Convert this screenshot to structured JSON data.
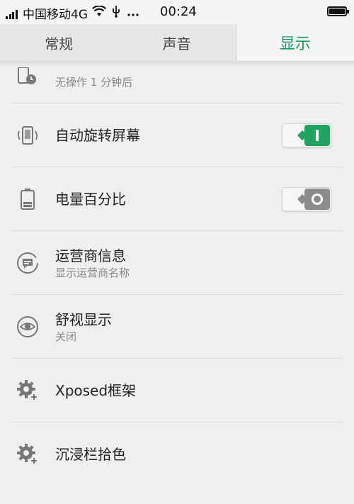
{
  "status_bar": {
    "carrier": "中国移动4G",
    "time": "00:24",
    "icons": [
      "signal-icon",
      "wifi-icon",
      "usb-icon",
      "more-icon",
      "battery-icon"
    ]
  },
  "tabs": [
    {
      "label": "常规",
      "active": false
    },
    {
      "label": "声音",
      "active": false
    },
    {
      "label": "显示",
      "active": true
    }
  ],
  "accent_color": "#1a9a5a",
  "settings": {
    "sleep": {
      "subtitle": "无操作 1 分钟后"
    },
    "auto_rotate": {
      "title": "自动旋转屏幕",
      "state": "on"
    },
    "battery_percent": {
      "title": "电量百分比",
      "state": "off"
    },
    "carrier_info": {
      "title": "运营商信息",
      "subtitle": "显示运营商名称"
    },
    "eye_comfort": {
      "title": "舒视显示",
      "subtitle": "关闭"
    },
    "xposed": {
      "title": "Xposed框架"
    },
    "immersive": {
      "title": "沉浸栏拾色"
    }
  }
}
